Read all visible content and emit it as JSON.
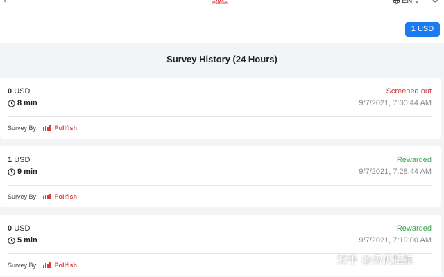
{
  "header": {
    "logo_text": "Pollfish",
    "language": "EN",
    "balance_label": "1 USD"
  },
  "page": {
    "title": "Survey History (24 Hours)"
  },
  "colors": {
    "accent": "#1a7cf0",
    "screened_out": "#c0393b",
    "rewarded": "#3aa757",
    "brand": "#d84040"
  },
  "surveys": [
    {
      "amount": "0",
      "currency": "USD",
      "duration": "8 min",
      "status": "Screened out",
      "datetime": "9/7/2021, 7:30:44 AM",
      "survey_by_label": "Survey By:",
      "provider": "Pollfish"
    },
    {
      "amount": "1",
      "currency": "USD",
      "duration": "9 min",
      "status": "Rewarded",
      "datetime": "9/7/2021, 7:28:44 AM",
      "survey_by_label": "Survey By:",
      "provider": "Pollfish"
    },
    {
      "amount": "0",
      "currency": "USD",
      "duration": "5 min",
      "status": "Rewarded",
      "datetime": "9/7/2021, 7:19:00 AM",
      "survey_by_label": "Survey By:",
      "provider": "Pollfish"
    }
  ],
  "watermark": "知乎 @扬帆起航"
}
